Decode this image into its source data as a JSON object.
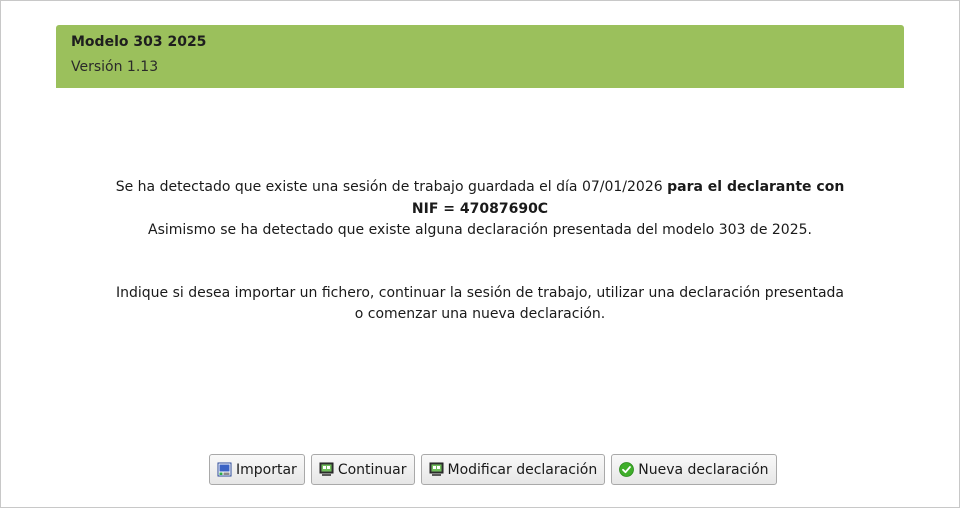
{
  "header": {
    "title": "Modelo 303 2025",
    "version": "Versión 1.13"
  },
  "message": {
    "line1_normal": "Se ha detectado que existe una sesión de trabajo guardada el día 07/01/2026 ",
    "line1_bold": "para el declarante con NIF = 47087690C",
    "line2": "Asimismo se ha detectado que existe alguna declaración presentada del modelo 303 de 2025.",
    "instruction": "Indique si desea importar un fichero, continuar la sesión de trabajo, utilizar una declaración presentada o comenzar una nueva declaración."
  },
  "buttons": {
    "importar": {
      "label": "Importar",
      "icon": "import-file-icon"
    },
    "continuar": {
      "label": "Continuar",
      "icon": "monitor-icon"
    },
    "modificar": {
      "label": "Modificar declaración",
      "icon": "monitor-icon"
    },
    "nueva": {
      "label": "Nueva declaración",
      "icon": "green-check-icon"
    }
  },
  "colors": {
    "header_bg": "#9bc05c",
    "panel_border": "#8c8c8c",
    "check_green": "#3fae2a"
  }
}
